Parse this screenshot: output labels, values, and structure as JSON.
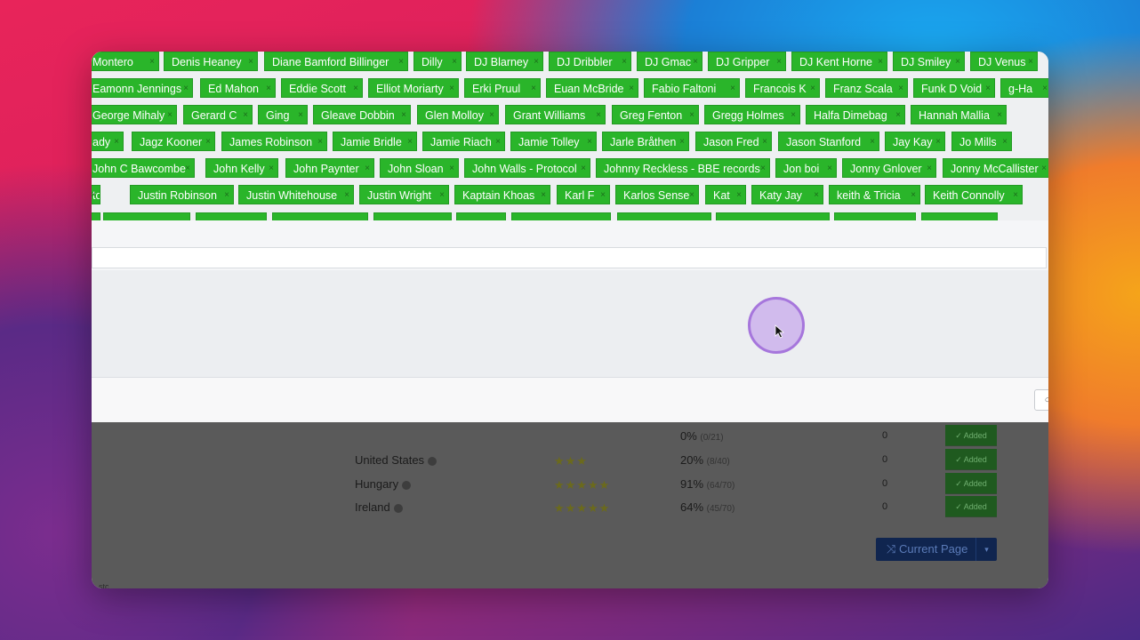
{
  "tags": {
    "row1": [
      "Montero",
      "Denis Heaney",
      "Diane Bamford Billinger",
      "Dilly",
      "DJ Blarney",
      "DJ Dribbler",
      "DJ Gmac",
      "DJ Gripper",
      "DJ Kent Horne",
      "DJ Smiley",
      "DJ Venus"
    ],
    "row2": [
      "Eamonn Jennings",
      "Ed Mahon",
      "Eddie Scott",
      "Elliot Moriarty",
      "Erki Pruul",
      "Euan McBride",
      "Fabio Faltoni",
      "Francois K",
      "Franz Scala",
      "Funk D Void",
      "g-Ha"
    ],
    "row3": [
      "George Mihaly",
      "Gerard C",
      "Ging",
      "Gleave Dobbin",
      "Glen Molloy",
      "Grant Williams",
      "Greg Fenton",
      "Gregg Holmes",
      "Halfa Dimebag",
      "Hannah Mallia"
    ],
    "row4": [
      "ady",
      "Jagz Kooner",
      "James Robinson",
      "Jamie Bridle",
      "Jamie Riach",
      "Jamie Tolley",
      "Jarle Bråthen",
      "Jason Fred",
      "Jason Stanford",
      "Jay Kay",
      "Jo Mills"
    ],
    "row5": [
      "John C Bawcombe",
      "John Kelly",
      "John Paynter",
      "John Sloan",
      "John Walls - Protocol",
      "Johnny Reckless - BBE records",
      "Jon boi",
      "Jonny Gnlover",
      "Jonny McCallister"
    ],
    "row6": [
      "ton",
      "Justin Robinson",
      "Justin Whitehouse",
      "Justin Wright",
      "Kaptain Khoas",
      "Karl F",
      "Karlos Sense",
      "Kat",
      "Katy Jay",
      "keith & Tricia",
      "Keith Connolly"
    ],
    "remove_glyph": "×"
  },
  "table": {
    "rows": [
      {
        "country": "",
        "stars": "",
        "pct": "0%",
        "detail": "(0/21)",
        "count": "0",
        "status": "✓ Added"
      },
      {
        "country": "United States",
        "stars": "★★★",
        "pct": "20%",
        "detail": "(8/40)",
        "count": "0",
        "status": "✓ Added"
      },
      {
        "country": "Hungary",
        "stars": "★★★★★",
        "pct": "91%",
        "detail": "(64/70)",
        "count": "0",
        "status": "✓ Added"
      },
      {
        "country": "Ireland",
        "stars": "★★★★★",
        "pct": "64%",
        "detail": "(45/70)",
        "count": "0",
        "status": "✓ Added"
      }
    ],
    "current_page_label": "Current Page",
    "current_page_icon": "⤨",
    "caret": "▾",
    "bottom_text": "stc"
  },
  "colors": {
    "tag_bg": "#2ab52a",
    "accent_cursor": "#a676dc"
  },
  "icons": {
    "cursor": "mouse-pointer-icon",
    "footer_search": "search-icon"
  }
}
